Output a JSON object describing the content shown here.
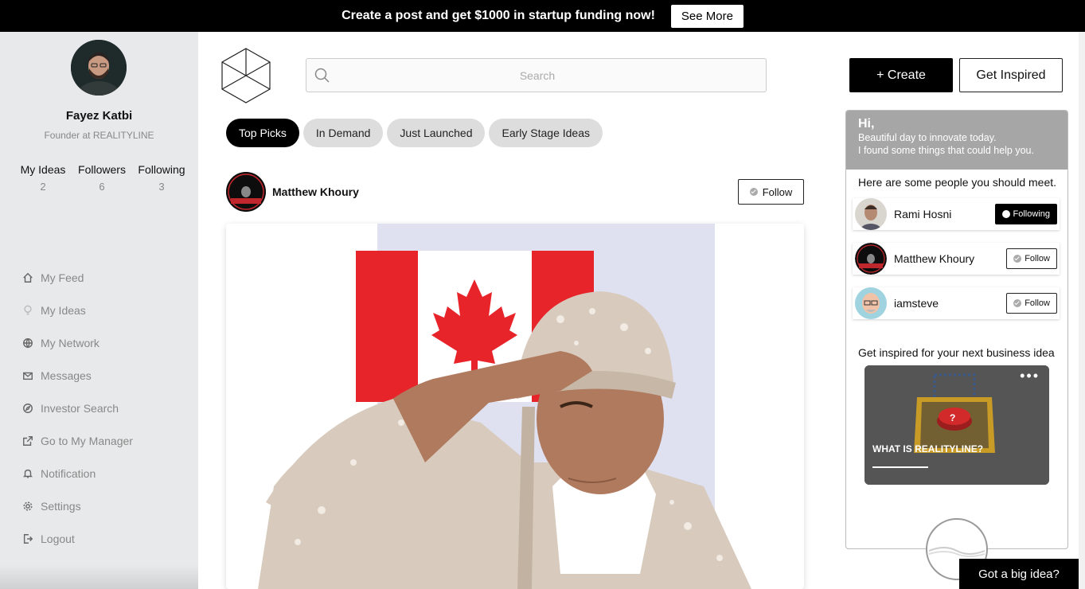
{
  "banner": {
    "text": "Create a post and get $1000 in startup funding now!",
    "button": "See More"
  },
  "profile": {
    "name": "Fayez Katbi",
    "role": "Founder at REALITYLINE",
    "stats": [
      {
        "label": "My Ideas",
        "value": "2"
      },
      {
        "label": "Followers",
        "value": "6"
      },
      {
        "label": "Following",
        "value": "3"
      }
    ]
  },
  "nav": [
    {
      "label": "My Feed",
      "icon": "home-icon"
    },
    {
      "label": "My Ideas",
      "icon": "lightbulb-icon"
    },
    {
      "label": "My Network",
      "icon": "globe-icon"
    },
    {
      "label": "Messages",
      "icon": "mail-icon"
    },
    {
      "label": "Investor Search",
      "icon": "compass-icon"
    },
    {
      "label": "Go to My Manager",
      "icon": "external-link-icon"
    },
    {
      "label": "Notification",
      "icon": "bell-icon"
    },
    {
      "label": "Settings",
      "icon": "gear-icon"
    },
    {
      "label": "Logout",
      "icon": "logout-icon"
    }
  ],
  "search": {
    "placeholder": "Search"
  },
  "header": {
    "create": "+ Create",
    "inspired": "Get Inspired"
  },
  "tabs": [
    "Top Picks",
    "In Demand",
    "Just Launched",
    "Early Stage Ideas"
  ],
  "post": {
    "author": "Matthew Khoury",
    "follow": "Follow"
  },
  "panel": {
    "hi": "Hi,",
    "line1": "Beautiful day to innovate today.",
    "line2": "I found some things that could help you.",
    "meet": "Here are some people you should meet.",
    "people": [
      {
        "name": "Rami Hosni",
        "button": "Following"
      },
      {
        "name": "Matthew Khoury",
        "button": "Follow"
      },
      {
        "name": "iamsteve",
        "button": "Follow"
      }
    ],
    "inspire": "Get inspired for your next business idea",
    "card_title": "WHAT IS REALITYLINE?"
  },
  "big_idea": "Got a big idea?",
  "colors": {
    "banner": "#000000",
    "sidebar": "#e8e9ea",
    "accent": "#000000",
    "flag_red": "#e8242b"
  }
}
